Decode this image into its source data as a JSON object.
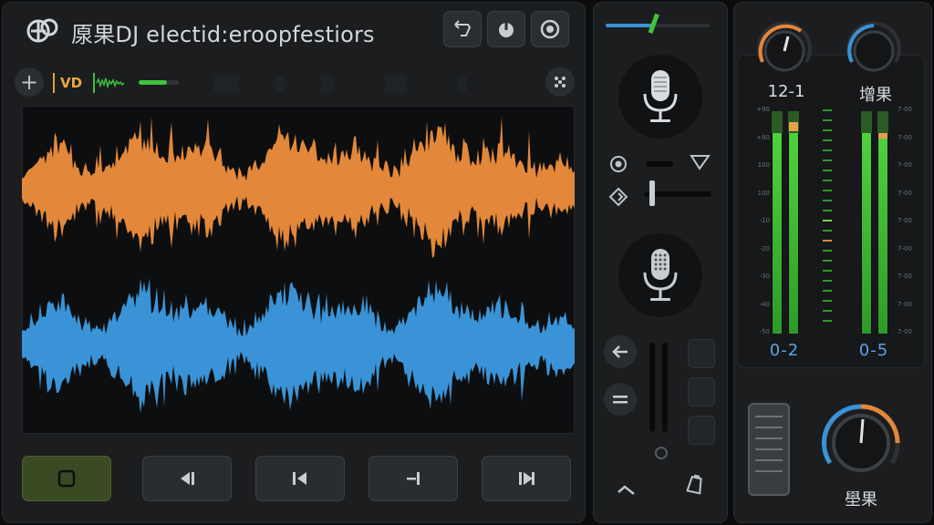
{
  "app": {
    "title": "厡果DJ electid:eroopfestiors",
    "logo_icon": "dj-logo-icon"
  },
  "header_buttons": [
    {
      "name": "loop-button",
      "icon": "loop-icon"
    },
    {
      "name": "power-button",
      "icon": "power-icon"
    },
    {
      "name": "target-button",
      "icon": "target-icon"
    }
  ],
  "toolbar": {
    "vd_label": "VD",
    "add_icon": "plus-icon",
    "level_percent": 70,
    "shuffle_icon": "dice-icon"
  },
  "waveform": {
    "deck_a_color": "#e3883a",
    "deck_b_color": "#3a93d6"
  },
  "transport": [
    {
      "name": "stop-button",
      "icon": "stop-icon"
    },
    {
      "name": "prev-button",
      "icon": "prev-icon"
    },
    {
      "name": "skip-back-button",
      "icon": "skip-back-icon"
    },
    {
      "name": "cue-button",
      "icon": "cue-icon"
    },
    {
      "name": "skip-forward-button",
      "icon": "skip-forward-icon"
    }
  ],
  "mixer": {
    "crossfade_percent": 45,
    "mic1_icon": "microphone-icon",
    "mic2_icon": "microphone-icon",
    "back_icon": "arrow-left-icon",
    "menu_icon": "equals-icon",
    "undo_icon": "undo-icon",
    "clip_icon": "clipboard-icon"
  },
  "channels": {
    "left": {
      "knob_label": "12-1",
      "value_label": "0-2",
      "level_percent": 90
    },
    "right": {
      "knob_label": "增果",
      "value_label": "0-5",
      "level_percent": 90
    },
    "scale_left": [
      "+90",
      "+80",
      "100",
      "100",
      "-10",
      "-20",
      "-30",
      "-40",
      "-50"
    ],
    "scale_right": [
      "7-00",
      "7-00",
      "7-00",
      "7-00",
      "7-00",
      "7-00",
      "7-00",
      "7-00",
      "7-00"
    ]
  },
  "master": {
    "knob_label": "壆果",
    "ring_percent": 70
  },
  "colors": {
    "accent_orange": "#e3883a",
    "accent_blue": "#3a93d6",
    "meter_green": "#3fc23c",
    "panel": "#1b1d1f"
  }
}
